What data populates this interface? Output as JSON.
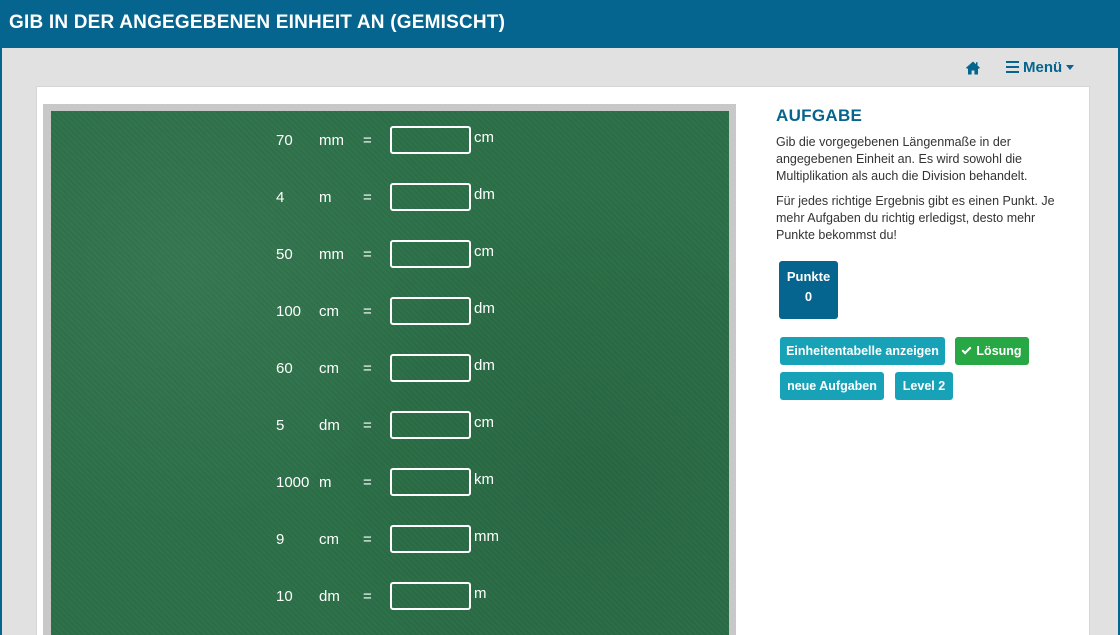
{
  "header": {
    "title": "GIB IN DER ANGEGEBENEN EINHEIT AN (GEMISCHT)"
  },
  "nav": {
    "home_icon": "home-icon",
    "menu_label": "Menü",
    "menu_icon": "bars-icon"
  },
  "exercises": [
    {
      "value": "70",
      "unit": "mm",
      "equals": "=",
      "answer": "",
      "target_unit": "cm"
    },
    {
      "value": "4",
      "unit": "m",
      "equals": "=",
      "answer": "",
      "target_unit": "dm"
    },
    {
      "value": "50",
      "unit": "mm",
      "equals": "=",
      "answer": "",
      "target_unit": "cm"
    },
    {
      "value": "100",
      "unit": "cm",
      "equals": "=",
      "answer": "",
      "target_unit": "dm"
    },
    {
      "value": "60",
      "unit": "cm",
      "equals": "=",
      "answer": "",
      "target_unit": "dm"
    },
    {
      "value": "5",
      "unit": "dm",
      "equals": "=",
      "answer": "",
      "target_unit": "cm"
    },
    {
      "value": "1000",
      "unit": "m",
      "equals": "=",
      "answer": "",
      "target_unit": "km"
    },
    {
      "value": "9",
      "unit": "cm",
      "equals": "=",
      "answer": "",
      "target_unit": "mm"
    },
    {
      "value": "10",
      "unit": "dm",
      "equals": "=",
      "answer": "",
      "target_unit": "m"
    }
  ],
  "task": {
    "heading": "AUFGABE",
    "paragraph1": "Gib die vorgegebenen Längenmaße in der angegebenen Einheit an. Es wird sowohl die Multiplikation als auch die Division behandelt.",
    "paragraph2": "Für jedes richtige Ergebnis gibt es einen Punkt. Je mehr Aufgaben du richtig erledigst, desto mehr Punkte bekommst du!"
  },
  "score": {
    "label": "Punkte",
    "value": "0"
  },
  "buttons": {
    "unit_table": "Einheitentabelle anzeigen",
    "solution": "Lösung",
    "new_tasks": "neue Aufgaben",
    "level": "Level 2"
  },
  "colors": {
    "primary": "#05658e",
    "info": "#17a2b8",
    "success": "#28a745",
    "board": "#2b6f47"
  }
}
